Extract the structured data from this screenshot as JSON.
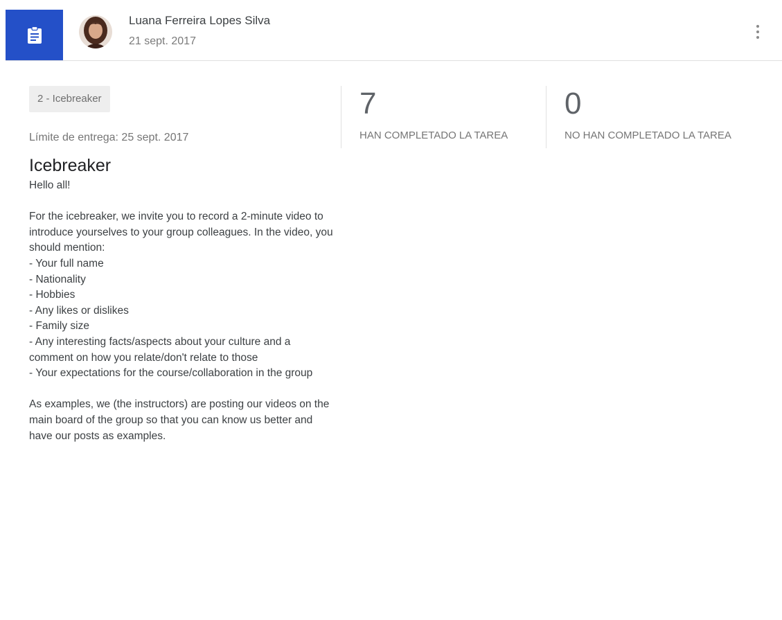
{
  "header": {
    "author_name": "Luana Ferreira Lopes Silva",
    "post_date": "21 sept. 2017",
    "badge_icon": "assignment-icon",
    "badge_color": "#2450c8",
    "more_icon": "more-vert-icon"
  },
  "assignment": {
    "topic": "2 - Icebreaker",
    "due_date": "Límite de entrega: 25 sept. 2017",
    "title": "Icebreaker",
    "body": {
      "greeting": "Hello all!",
      "intro": "For the icebreaker, we invite you to record a 2-minute video to introduce yourselves to your group colleagues. In the video, you should mention:",
      "items": [
        "- Your full name",
        "- Nationality",
        "- Hobbies",
        "- Any likes or dislikes",
        "- Family size",
        "- Any interesting facts/aspects about your culture and a comment on how you relate/don't relate to those",
        "- Your expectations for the course/collaboration in the group"
      ],
      "closing": "As examples, we (the instructors) are posting our videos on the main board of the group so that you can know us better and have our posts as examples."
    }
  },
  "stats": {
    "completed_count": "7",
    "completed_label": "HAN COMPLETADO LA TAREA",
    "not_completed_count": "0",
    "not_completed_label": "NO HAN COMPLETADO LA TAREA"
  }
}
